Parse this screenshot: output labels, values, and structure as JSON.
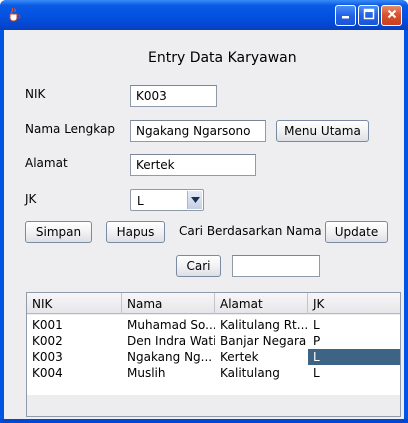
{
  "window": {
    "title": ""
  },
  "form": {
    "heading": "Entry Data Karyawan",
    "nik_label": "NIK",
    "nik_value": "K003",
    "nama_label": "Nama Lengkap",
    "nama_value": "Ngakang Ngarsono",
    "alamat_label": "Alamat",
    "alamat_value": "Kertek",
    "jk_label": "JK",
    "jk_value": "L",
    "search_label": "Cari Berdasarkan Nama",
    "search_value": ""
  },
  "buttons": {
    "menu_utama": "Menu Utama",
    "simpan": "Simpan",
    "hapus": "Hapus",
    "update": "Update",
    "cari": "Cari"
  },
  "table": {
    "columns": [
      "NIK",
      "Nama",
      "Alamat",
      "JK"
    ],
    "rows": [
      [
        "K001",
        "Muhamad So...",
        "Kalitulang Rt....",
        "L"
      ],
      [
        "K002",
        "Den Indra Wati",
        "Banjar Negara",
        "P"
      ],
      [
        "K003",
        "Ngakang Ng...",
        "Kertek",
        "L"
      ],
      [
        "K004",
        "Muslih",
        "Kalitulang",
        "L"
      ]
    ],
    "selected_row": 2,
    "selected_col": 3
  },
  "colors": {
    "title_bar": "#0451e0",
    "selection": "#3d6385",
    "client_bg": "#eeeef0"
  },
  "icons": {
    "app": "java-coffee-icon",
    "minimize": "minimize-icon",
    "maximize": "maximize-icon",
    "close": "close-icon",
    "dropdown": "chevron-down-icon"
  }
}
